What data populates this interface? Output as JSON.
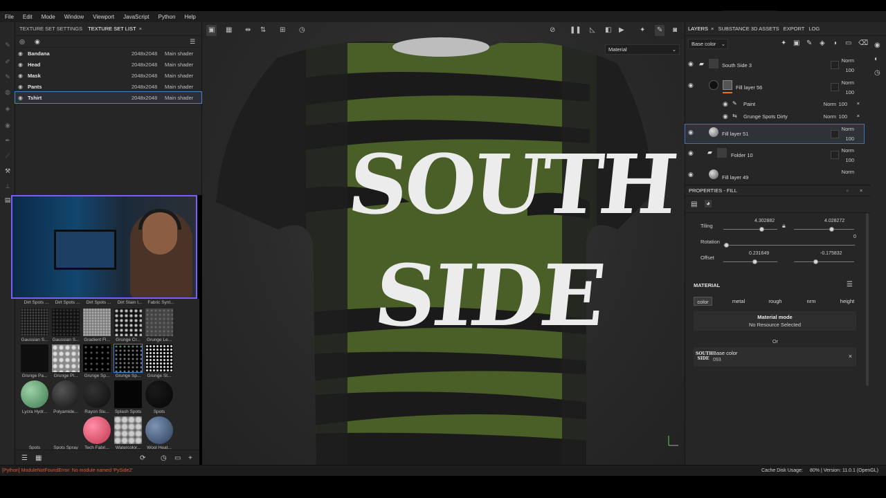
{
  "menu": [
    "File",
    "Edit",
    "Mode",
    "Window",
    "Viewport",
    "JavaScript",
    "Python",
    "Help"
  ],
  "texture_set_panel": {
    "tabs": [
      "TEXTURE SET SETTINGS",
      "TEXTURE SET LIST"
    ],
    "close": "×",
    "rows": [
      {
        "name": "Bandana",
        "resolution": "2048x2048",
        "shader": "Main shader"
      },
      {
        "name": "Head",
        "resolution": "2048x2048",
        "shader": "Main shader"
      },
      {
        "name": "Mask",
        "resolution": "2048x2048",
        "shader": "Main shader"
      },
      {
        "name": "Pants",
        "resolution": "2048x2048",
        "shader": "Main shader"
      },
      {
        "name": "Tshirt",
        "resolution": "2048x2048",
        "shader": "Main shader"
      }
    ]
  },
  "shelf": {
    "top_labels": [
      "Dirt Spots ...",
      "Dirt Spots ...",
      "Dirt Spots ...",
      "Dirt Stain I...",
      "Fabric Synt..."
    ],
    "items": [
      {
        "label": "Gaussian S..."
      },
      {
        "label": "Gaussian S..."
      },
      {
        "label": "Gradient Fl..."
      },
      {
        "label": "Grunge Cr..."
      },
      {
        "label": "Grunge Le..."
      },
      {
        "label": "Grunge Pa..."
      },
      {
        "label": "Grunge Pl..."
      },
      {
        "label": "Grunge Sp..."
      },
      {
        "label": "Grunge Sp..."
      },
      {
        "label": "Grunge St..."
      },
      {
        "label": "Lycra Hydr..."
      },
      {
        "label": "Polyamide..."
      },
      {
        "label": "Rayon Slu..."
      },
      {
        "label": "Splash Spots"
      },
      {
        "label": "Spots"
      },
      {
        "label": "Spots"
      },
      {
        "label": "Spots Spray"
      },
      {
        "label": "Tech Fabri..."
      },
      {
        "label": "Watercolor..."
      },
      {
        "label": "Wool Heat..."
      }
    ]
  },
  "viewport": {
    "material_select": "Material",
    "shirt_text_line1": "SOUTH",
    "shirt_text_line2": "SIDE"
  },
  "layers_panel": {
    "tabs": [
      "LAYERS",
      "SUBSTANCE 3D ASSETS",
      "EXPORT",
      "LOG"
    ],
    "close": "×",
    "channel": "Base color",
    "layers": [
      {
        "name": "South Side 3",
        "blend": "Norm",
        "opacity": "100"
      },
      {
        "name": "Fill layer 56",
        "blend": "Norm",
        "opacity": "100"
      },
      {
        "name": "Paint",
        "blend": "Norm",
        "opacity": "100"
      },
      {
        "name": "Grunge Spots Dirty",
        "blend": "Norm",
        "opacity": "100"
      },
      {
        "name": "Fill layer 51",
        "blend": "Norm",
        "opacity": "100"
      },
      {
        "name": "Folder 10",
        "blend": "Norm",
        "opacity": "100"
      },
      {
        "name": "Fill layer 49",
        "blend": "Norm",
        "opacity": ""
      }
    ]
  },
  "properties": {
    "title": "PROPERTIES - FILL",
    "tiling_label": "Tiling",
    "tiling_u": "4.302882",
    "tiling_v": "4.028272",
    "rotation_label": "Rotation",
    "rotation_value": "0",
    "offset_label": "Offset",
    "offset_u": "0.231649",
    "offset_v": "-0.175832",
    "material_section": "MATERIAL",
    "channels": [
      "color",
      "metal",
      "rough",
      "nrm",
      "height"
    ],
    "material_mode_title": "Material mode",
    "material_mode_sub": "No Resource Selected",
    "or": "Or",
    "resource_name": "Base color",
    "resource_sub": "093",
    "resource_logo_l1": "SOUTH",
    "resource_logo_l2": "SIDE"
  },
  "statusbar": {
    "error": "[Python] ModuleNotFoundError: No module named 'PySide2'",
    "cache": "Cache Disk Usage:",
    "version": "80% | Version: 11.0.1 (OpenGL)"
  },
  "colors": {
    "panel": "#262626",
    "accent_blue": "#4a7fd6",
    "error_red": "#e05a3a",
    "shirt_green": "#4a5e28"
  }
}
